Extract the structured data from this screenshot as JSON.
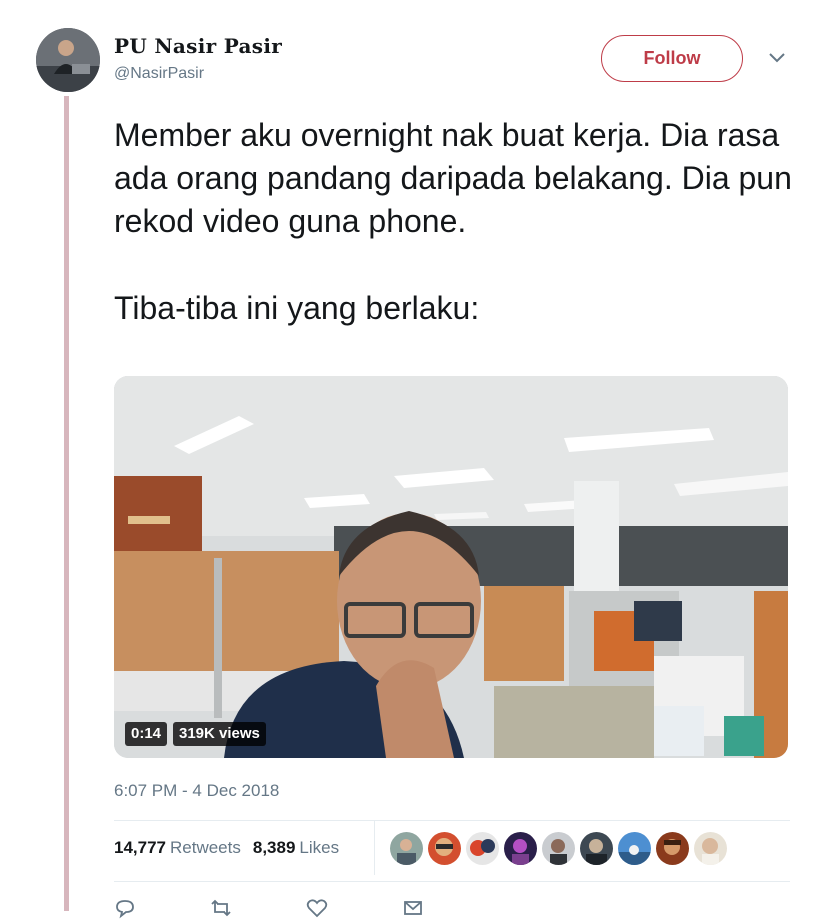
{
  "author": {
    "name": "PU Nasir Pasir",
    "handle": "@NasirPasir",
    "avatar_icon": "profile-photo"
  },
  "follow_label": "Follow",
  "more_icon": "chevron-down-icon",
  "tweet": {
    "line1": "Member aku overnight nak buat kerja. Dia rasa ada orang pandang daripada belakang. Dia pun rekod video guna phone.",
    "line2": "Tiba-tiba ini yang berlaku:"
  },
  "video": {
    "duration": "0:14",
    "views": "319K views",
    "description_icon": "video-thumbnail-office-man"
  },
  "timestamp": "6:07 PM - 4 Dec 2018",
  "stats": {
    "retweets_count": "14,777",
    "retweets_label": "Retweets",
    "likes_count": "8,389",
    "likes_label": "Likes"
  },
  "likers_count_shown": 9,
  "colors": {
    "accent": "#be3c48",
    "thread_line": "#d7b6bd",
    "muted": "#657786"
  },
  "actions": {
    "reply_icon": "reply-icon",
    "retweet_icon": "retweet-icon",
    "like_icon": "heart-icon",
    "dm_icon": "message-icon"
  }
}
